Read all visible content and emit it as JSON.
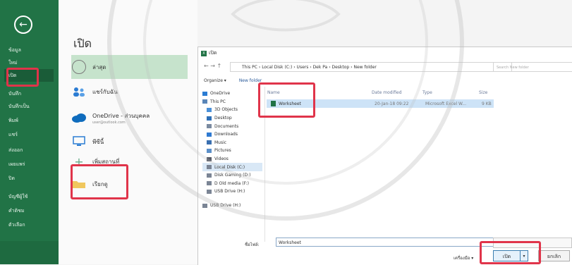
{
  "sidebar": {
    "items": [
      "ข้อมูล",
      "ใหม่",
      "เปิด",
      "บันทึก",
      "บันทึกเป็น",
      "พิมพ์",
      "แชร์",
      "ส่งออก",
      "เผยแพร่",
      "ปิด",
      "บัญชีผู้ใช้",
      "คำติชม",
      "ตัวเลือก"
    ]
  },
  "panel": {
    "title": "เปิด",
    "places": [
      {
        "label": "ล่าสุด",
        "sub": ""
      },
      {
        "label": "แชร์กับฉัน",
        "sub": ""
      },
      {
        "label": "OneDrive - ส่วนบุคคล",
        "sub": "user@outlook.com"
      },
      {
        "label": "พีซีนี้",
        "sub": ""
      },
      {
        "label": "เพิ่มสถานที่",
        "sub": ""
      },
      {
        "label": "เรียกดู",
        "sub": ""
      }
    ]
  },
  "dialog": {
    "title": "เปิด",
    "address": "This PC  ›  Local Disk (C:)  ›  Users  ›  Dek Pa  ›  Desktop  ›  New folder",
    "search_placeholder": "Search New folder",
    "organize": "Organize ▾",
    "new_folder": "New folder",
    "nav": [
      {
        "label": "OneDrive",
        "color": "#2b7cd3",
        "indent": false
      },
      {
        "label": "This PC",
        "color": "#5a86b8",
        "indent": false
      },
      {
        "label": "3D Objects",
        "color": "#4a90d9",
        "indent": true
      },
      {
        "label": "Desktop",
        "color": "#2e6fb7",
        "indent": true
      },
      {
        "label": "Documents",
        "color": "#7a8aa0",
        "indent": true
      },
      {
        "label": "Downloads",
        "color": "#2f7ad1",
        "indent": true
      },
      {
        "label": "Music",
        "color": "#3a6fb0",
        "indent": true
      },
      {
        "label": "Pictures",
        "color": "#5b8fc9",
        "indent": true
      },
      {
        "label": "Videos",
        "color": "#555a66",
        "indent": true
      },
      {
        "label": "Local Disk (C:)",
        "color": "#7b8595",
        "indent": true
      },
      {
        "label": "Disk Gaming (D:)",
        "color": "#7b8595",
        "indent": true
      },
      {
        "label": "D Old media (F:)",
        "color": "#7b8595",
        "indent": true
      },
      {
        "label": "USB Drive (H:)",
        "color": "#7b8595",
        "indent": true
      },
      {
        "label": "USB Drive (H:)",
        "color": "#7b8595",
        "indent": false
      }
    ],
    "columns": [
      "Name",
      "Date modified",
      "Type",
      "Size"
    ],
    "file": {
      "name": "Worksheet",
      "date": "20-Jan-18 09:22",
      "type": "Microsoft Excel W...",
      "size": "9 KB"
    },
    "filename_label": "ชื่อไฟล์:",
    "filename_value": "Worksheet",
    "tools_label": "เครื่องมือ",
    "open_label": "เปิด",
    "cancel_label": "ยกเลิก"
  },
  "colors": {
    "excel_green": "#217346",
    "highlight": "#e0344a"
  }
}
